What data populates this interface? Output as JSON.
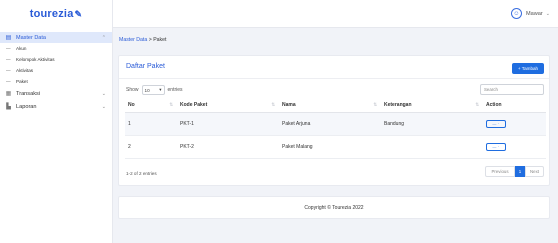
{
  "brand": {
    "name": "tourezia"
  },
  "sidebar": {
    "items": [
      {
        "label": "Master Data",
        "icon": "database-icon",
        "active": true
      },
      {
        "label": "Transaksi",
        "icon": "table-icon"
      },
      {
        "label": "Laporan",
        "icon": "report-icon"
      }
    ],
    "sub_items": [
      {
        "label": "Akun"
      },
      {
        "label": "Kelompok Aktivitas"
      },
      {
        "label": "Aktivitas"
      },
      {
        "label": "Paket"
      }
    ]
  },
  "topbar": {
    "user_name": "Mawar",
    "avatar_icon": "user-circle-icon"
  },
  "breadcrumb": {
    "parent": "Master Data",
    "separator": ">",
    "current": "Paket"
  },
  "card": {
    "title": "Daftar Paket",
    "add_button": "+ Tambah",
    "show_prefix": "Show",
    "show_value": "10",
    "show_suffix": "entries",
    "search_placeholder": "Search",
    "columns": [
      "No",
      "Kode Paket",
      "Nama",
      "Keterangan",
      "Action"
    ],
    "rows": [
      {
        "no": "1",
        "kode": "PKT-1",
        "nama": "Paket Arjuna",
        "keterangan": "Bandung",
        "action": "— ·"
      },
      {
        "no": "2",
        "kode": "PKT-2",
        "nama": "Paket Malang",
        "keterangan": "",
        "action": "— ·"
      }
    ],
    "info": "1-2 of 2 entries",
    "pagination": {
      "previous": "Previous",
      "current": "1",
      "next": "Next"
    }
  },
  "footer": {
    "text": "Copyright © Tourezia 2022"
  },
  "colors": {
    "accent": "#1f6de0",
    "brand": "#2a5bd7",
    "active_bg": "#dfe8fb"
  }
}
